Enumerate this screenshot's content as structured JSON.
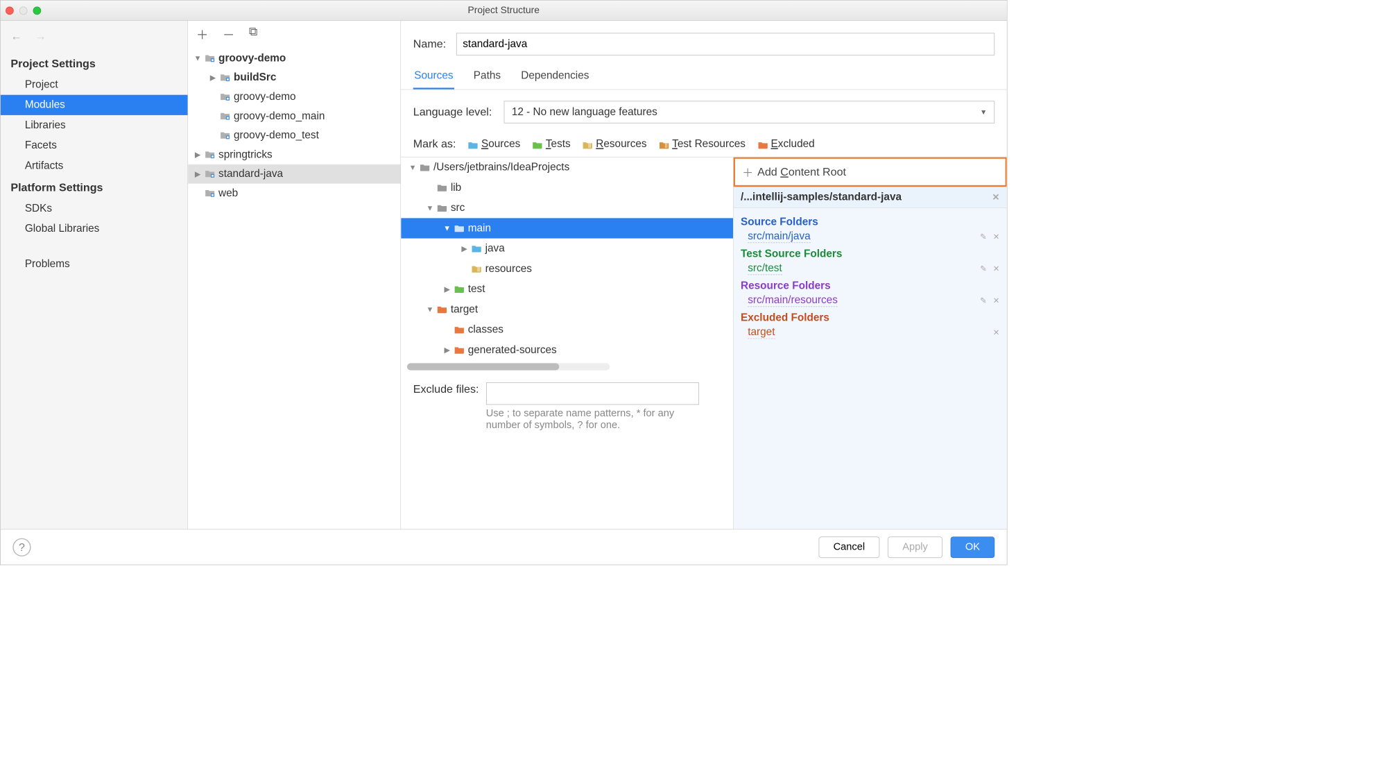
{
  "window": {
    "title": "Project Structure"
  },
  "sidebar": {
    "sections": [
      {
        "label": "Project Settings",
        "items": [
          "Project",
          "Modules",
          "Libraries",
          "Facets",
          "Artifacts"
        ],
        "selected": 1
      },
      {
        "label": "Platform Settings",
        "items": [
          "SDKs",
          "Global Libraries"
        ],
        "selected": -1
      }
    ],
    "bottom_item": "Problems"
  },
  "modules_tree": [
    {
      "d": 0,
      "exp": "open",
      "icon": "module-group",
      "label": "groovy-demo",
      "bold": true
    },
    {
      "d": 1,
      "exp": "closed",
      "icon": "module-group",
      "label": "buildSrc",
      "bold": true
    },
    {
      "d": 1,
      "exp": "",
      "icon": "module",
      "label": "groovy-demo"
    },
    {
      "d": 1,
      "exp": "",
      "icon": "module",
      "label": "groovy-demo_main"
    },
    {
      "d": 1,
      "exp": "",
      "icon": "module",
      "label": "groovy-demo_test"
    },
    {
      "d": 0,
      "exp": "closed",
      "icon": "module-group",
      "label": "springtricks"
    },
    {
      "d": 0,
      "exp": "closed",
      "icon": "module",
      "label": "standard-java",
      "sel": true
    },
    {
      "d": 0,
      "exp": "",
      "icon": "module",
      "label": "web"
    }
  ],
  "main": {
    "name_label": "Name:",
    "name_value": "standard-java",
    "tabs": [
      "Sources",
      "Paths",
      "Dependencies"
    ],
    "active_tab": 0,
    "lang_label": "Language level:",
    "lang_value": "12 - No new language features",
    "mark_label": "Mark as:",
    "mark_options": [
      {
        "label": "Sources",
        "letter": "S",
        "color": "#5bb3e6"
      },
      {
        "label": "Tests",
        "letter": "T",
        "color": "#6bbf4b"
      },
      {
        "label": "Resources",
        "letter": "R",
        "color": "#d9b65a"
      },
      {
        "label": "Test Resources",
        "letter": "T",
        "color": "#d98f3a"
      },
      {
        "label": "Excluded",
        "letter": "E",
        "color": "#e8783e"
      }
    ],
    "folder_tree": [
      {
        "d": 0,
        "exp": "open",
        "color": "#9a9a9a",
        "label": "/Users/jetbrains/IdeaProjects"
      },
      {
        "d": 1,
        "exp": "",
        "color": "#9a9a9a",
        "label": "lib"
      },
      {
        "d": 1,
        "exp": "open",
        "color": "#9a9a9a",
        "label": "src"
      },
      {
        "d": 2,
        "exp": "open",
        "color": "#9a9a9a",
        "label": "main",
        "sel": true
      },
      {
        "d": 3,
        "exp": "closed",
        "color": "#5bb3e6",
        "label": "java"
      },
      {
        "d": 3,
        "exp": "",
        "color": "#d9b65a",
        "label": "resources",
        "stripe": true
      },
      {
        "d": 2,
        "exp": "closed",
        "color": "#6bbf4b",
        "label": "test"
      },
      {
        "d": 1,
        "exp": "open",
        "color": "#e8783e",
        "label": "target"
      },
      {
        "d": 2,
        "exp": "",
        "color": "#e8783e",
        "label": "classes"
      },
      {
        "d": 2,
        "exp": "closed",
        "color": "#e8783e",
        "label": "generated-sources"
      }
    ],
    "exclude_label": "Exclude files:",
    "exclude_help": "Use ; to separate name patterns, * for any number of symbols, ? for one."
  },
  "right": {
    "add_label": "Add Content Root",
    "root_path": "/...intellij-samples/standard-java",
    "groups": [
      {
        "title": "Source Folders",
        "cls": "src",
        "items": [
          "src/main/java"
        ]
      },
      {
        "title": "Test Source Folders",
        "cls": "test",
        "items": [
          "src/test"
        ]
      },
      {
        "title": "Resource Folders",
        "cls": "res",
        "items": [
          "src/main/resources"
        ]
      },
      {
        "title": "Excluded Folders",
        "cls": "exc",
        "items": [
          "target"
        ]
      }
    ]
  },
  "footer": {
    "cancel": "Cancel",
    "apply": "Apply",
    "ok": "OK"
  }
}
